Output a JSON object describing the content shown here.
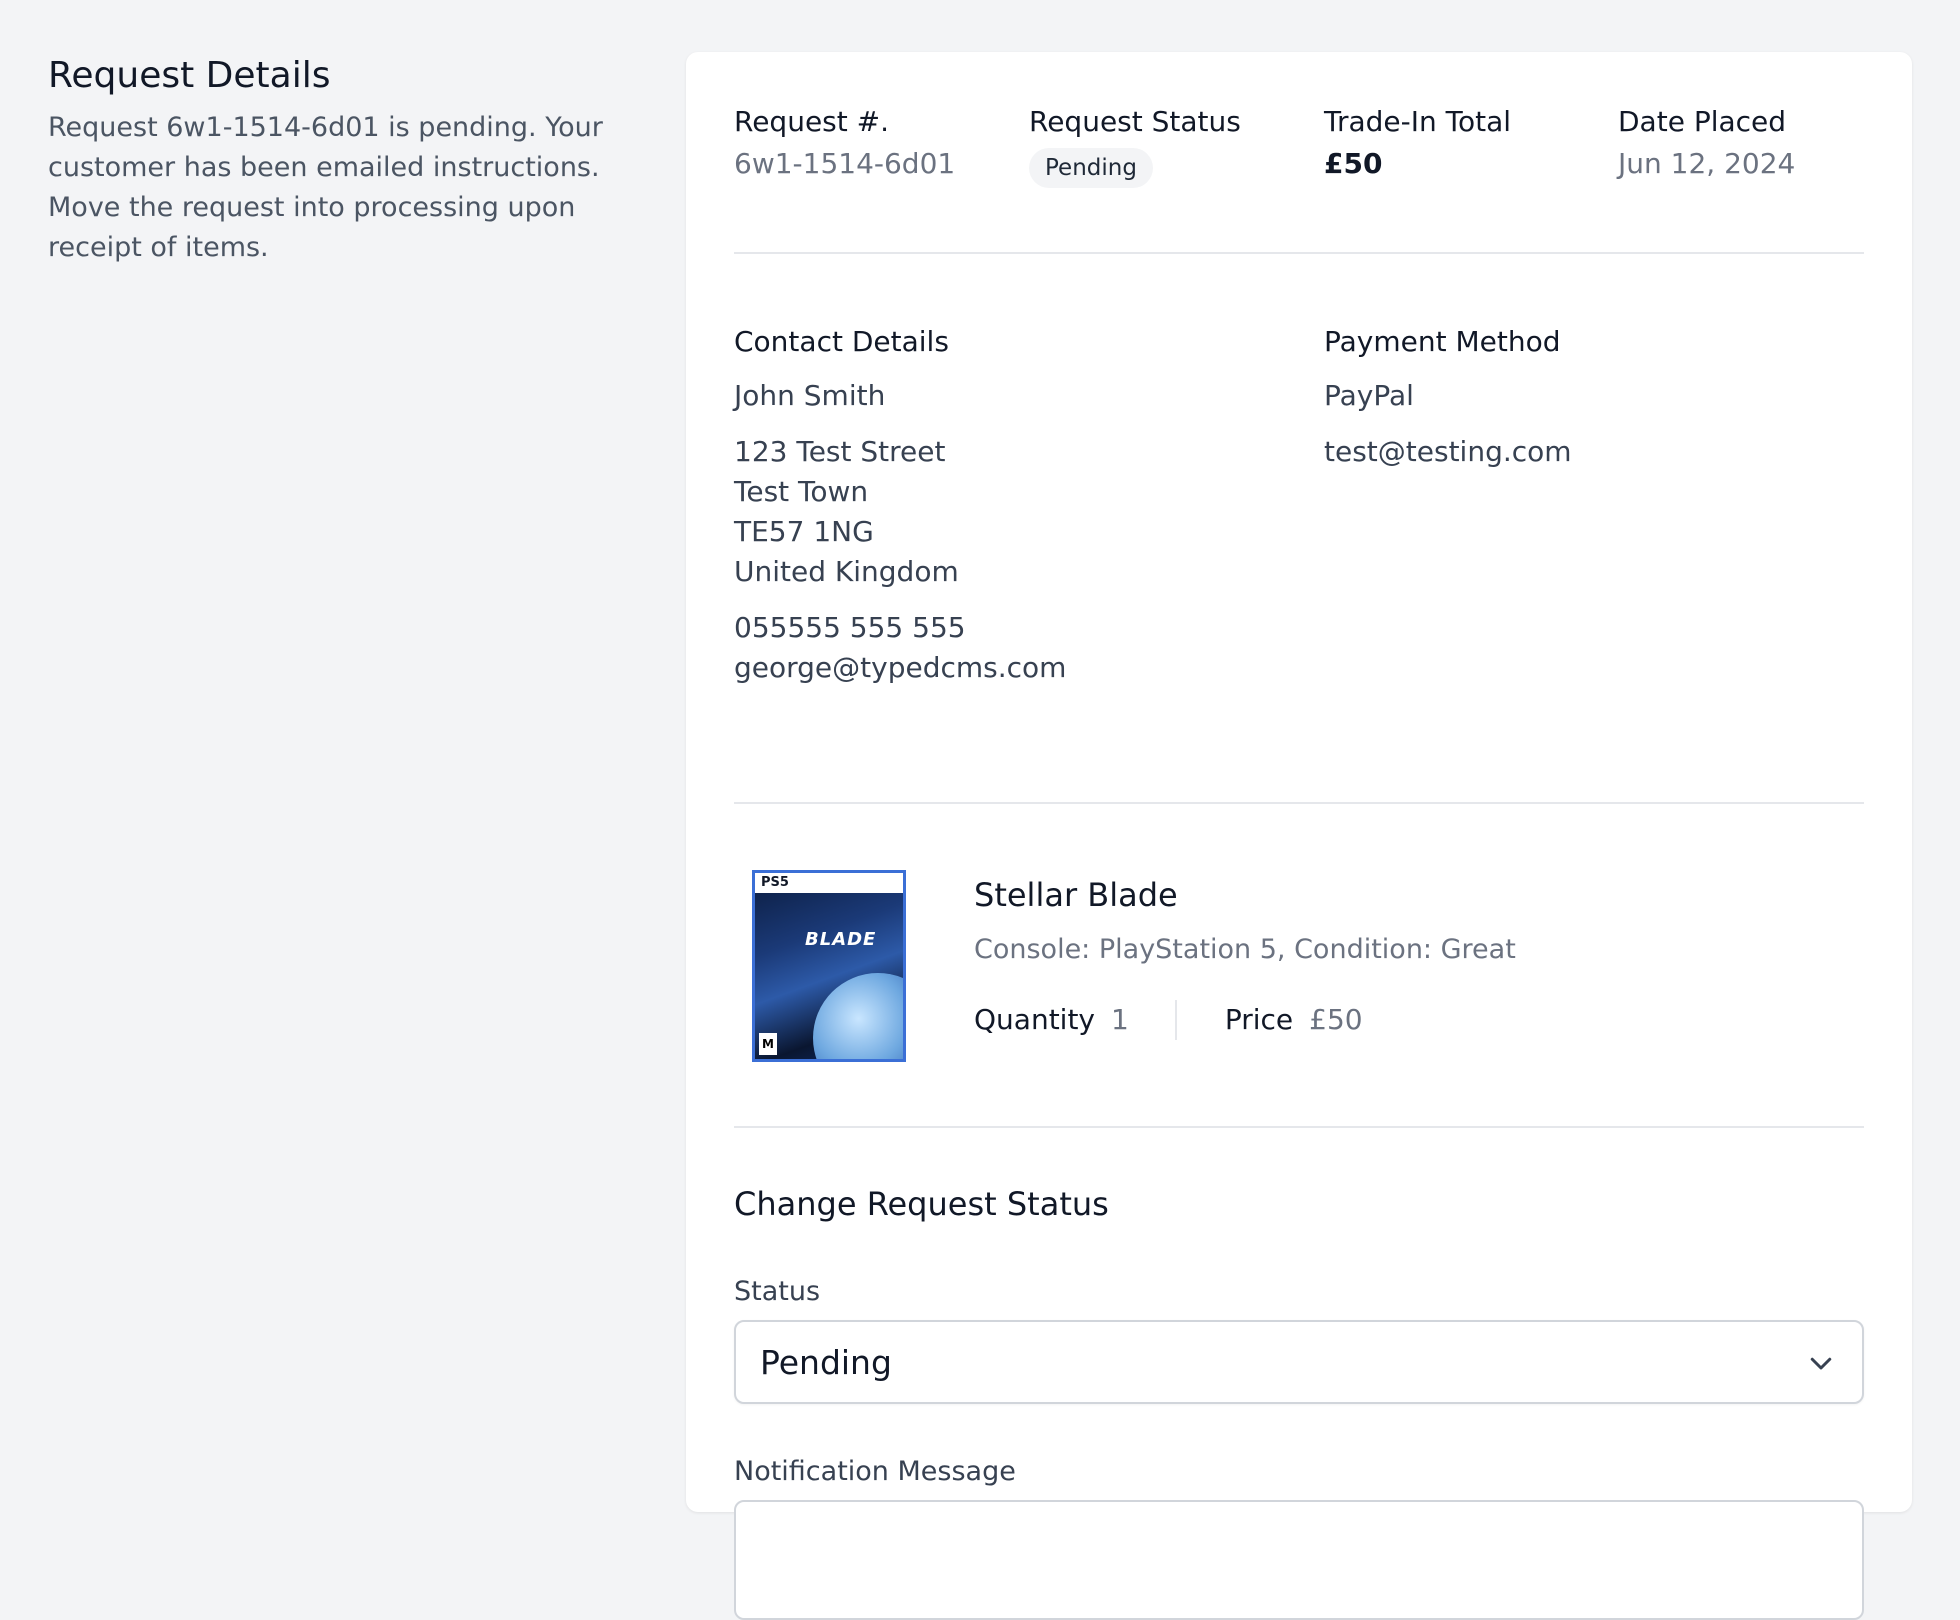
{
  "intro": {
    "title": "Request Details",
    "description": "Request 6w1-1514-6d01 is pending. Your customer has been emailed instructions. Move the request into processing upon receipt of items."
  },
  "summary": {
    "request_number_label": "Request #.",
    "request_number": "6w1-1514-6d01",
    "status_label": "Request Status",
    "status": "Pending",
    "total_label": "Trade-In Total",
    "total": "£50",
    "date_label": "Date Placed",
    "date": "Jun 12, 2024"
  },
  "contact": {
    "label": "Contact Details",
    "name": "John Smith",
    "address": [
      "123 Test Street",
      "Test Town",
      "TE57 1NG",
      "United Kingdom"
    ],
    "phone": "055555 555 555",
    "email": "george@typedcms.com"
  },
  "payment": {
    "label": "Payment Method",
    "method": "PayPal",
    "email": "test@testing.com"
  },
  "product": {
    "name": "Stellar Blade",
    "meta": "Console: PlayStation 5, Condition: Great",
    "quantity_label": "Quantity",
    "quantity": "1",
    "price_label": "Price",
    "price": "£50",
    "cover_platform": "PS5",
    "cover_title": "BLADE",
    "cover_rating": "M"
  },
  "form": {
    "title": "Change Request Status",
    "status_label": "Status",
    "status_value": "Pending",
    "notification_label": "Notification Message"
  },
  "colors": {
    "background": "#f3f4f6",
    "card": "#ffffff",
    "divider": "#e5e7eb",
    "muted_text": "#6b7280",
    "cover_border": "#3b6fd6"
  }
}
